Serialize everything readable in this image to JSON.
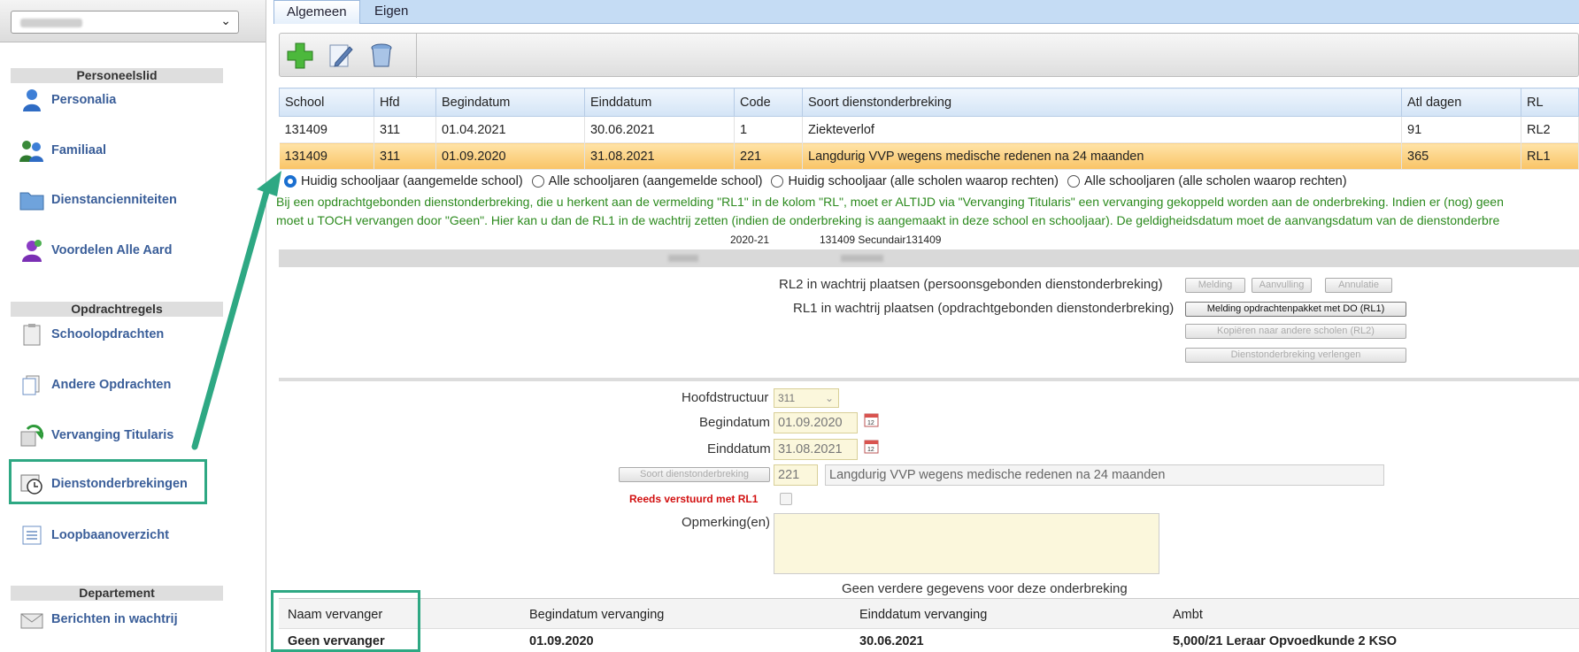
{
  "sidebar": {
    "sections": [
      {
        "title": "Personeelslid",
        "items": [
          {
            "label": "Personalia",
            "icon": "person-icon"
          },
          {
            "label": "Familiaal",
            "icon": "family-icon"
          },
          {
            "label": "Dienstancienniteiten",
            "icon": "folder-icon"
          },
          {
            "label": "Voordelen Alle Aard",
            "icon": "person-purple-icon"
          }
        ]
      },
      {
        "title": "Opdrachtregels",
        "items": [
          {
            "label": "Schoolopdrachten",
            "icon": "clipboard-icon"
          },
          {
            "label": "Andere Opdrachten",
            "icon": "documents-icon"
          },
          {
            "label": "Vervanging Titularis",
            "icon": "replace-icon"
          },
          {
            "label": "Dienstonderbrekingen",
            "icon": "clock-icon"
          },
          {
            "label": "Loopbaanoverzicht",
            "icon": "list-icon"
          }
        ]
      },
      {
        "title": "Departement",
        "items": [
          {
            "label": "Berichten in wachtrij",
            "icon": "envelope-icon"
          }
        ]
      }
    ]
  },
  "tabs": [
    "Algemeen",
    "Eigen"
  ],
  "toolbar": {
    "add": "add-icon",
    "edit": "edit-icon",
    "delete": "delete-icon"
  },
  "grid": {
    "columns": [
      "School",
      "Hfd",
      "Begindatum",
      "Einddatum",
      "Code",
      "Soort dienstonderbreking",
      "Atl dagen",
      "RL"
    ],
    "rows": [
      [
        "131409",
        "311",
        "01.04.2021",
        "30.06.2021",
        "1",
        "Ziekteverlof",
        "91",
        "RL2"
      ],
      [
        "131409",
        "311",
        "01.09.2020",
        "31.08.2021",
        "221",
        "Langdurig VVP wegens medische redenen na 24 maanden",
        "365",
        "RL1"
      ]
    ]
  },
  "radios": [
    {
      "label": "Huidig schooljaar (aangemelde school)",
      "checked": true
    },
    {
      "label": "Alle schooljaren (aangemelde school)",
      "checked": false
    },
    {
      "label": "Huidig schooljaar (alle scholen waarop rechten)",
      "checked": false
    },
    {
      "label": "Alle schooljaren (alle scholen waarop rechten)",
      "checked": false
    }
  ],
  "info": {
    "line1": "Bij een opdrachtgebonden dienstonderbreking, die u herkent aan de vermelding \"RL1\" in de kolom \"RL\", moet er ALTIJD via \"Vervanging Titularis\" een vervanging gekoppeld worden aan de onderbreking. Indien er (nog) geen",
    "line2": "moet u TOCH vervangen door \"Geen\". Hier kan u dan de RL1 in de wachtrij zetten (indien de onderbreking is aangemaakt in deze school en schooljaar). De geldigheidsdatum moet de aanvangsdatum van de dienstonderbre",
    "schooljaar": "2020-21",
    "school": "131409 Secundair131409"
  },
  "wachtrij": {
    "rl2_label": "RL2 in wachtrij plaatsen (persoonsgebonden dienstonderbreking)",
    "rl1_label": "RL1 in wachtrij plaatsen (opdrachtgebonden dienstonderbreking)",
    "melding": "Melding",
    "aanvulling": "Aanvulling",
    "annulatie": "Annulatie",
    "melding_pakket": "Melding opdrachtenpakket met DO (RL1)",
    "kopieren": "Kopiëren naar andere scholen (RL2)",
    "verlengen": "Dienstonderbreking verlengen"
  },
  "form": {
    "hoofdstructuur_label": "Hoofdstructuur",
    "hoofdstructuur_value": "311",
    "begindatum_label": "Begindatum",
    "begindatum_value": "01.09.2020",
    "einddatum_label": "Einddatum",
    "einddatum_value": "31.08.2021",
    "soort_button": "Soort dienstonderbreking",
    "soort_code": "221",
    "soort_text": "Langdurig VVP wegens medische redenen na 24 maanden",
    "reeds_label": "Reeds verstuurd met RL1",
    "opmerking_label": "Opmerking(en)",
    "note": "Geen verdere gegevens voor deze onderbreking"
  },
  "vervanging": {
    "columns": [
      "Naam vervanger",
      "Begindatum vervanging",
      "Einddatum vervanging",
      "Ambt"
    ],
    "row": [
      "Geen vervanger",
      "01.09.2020",
      "30.06.2021",
      "5,000/21 Leraar Opvoedkunde 2 KSO"
    ]
  },
  "colors": {
    "accent_green": "#2ea883",
    "selected_row": "#f9c466",
    "nav_text": "#3a5e99",
    "info_green": "#2c8a1e",
    "required_red": "#d21010"
  }
}
